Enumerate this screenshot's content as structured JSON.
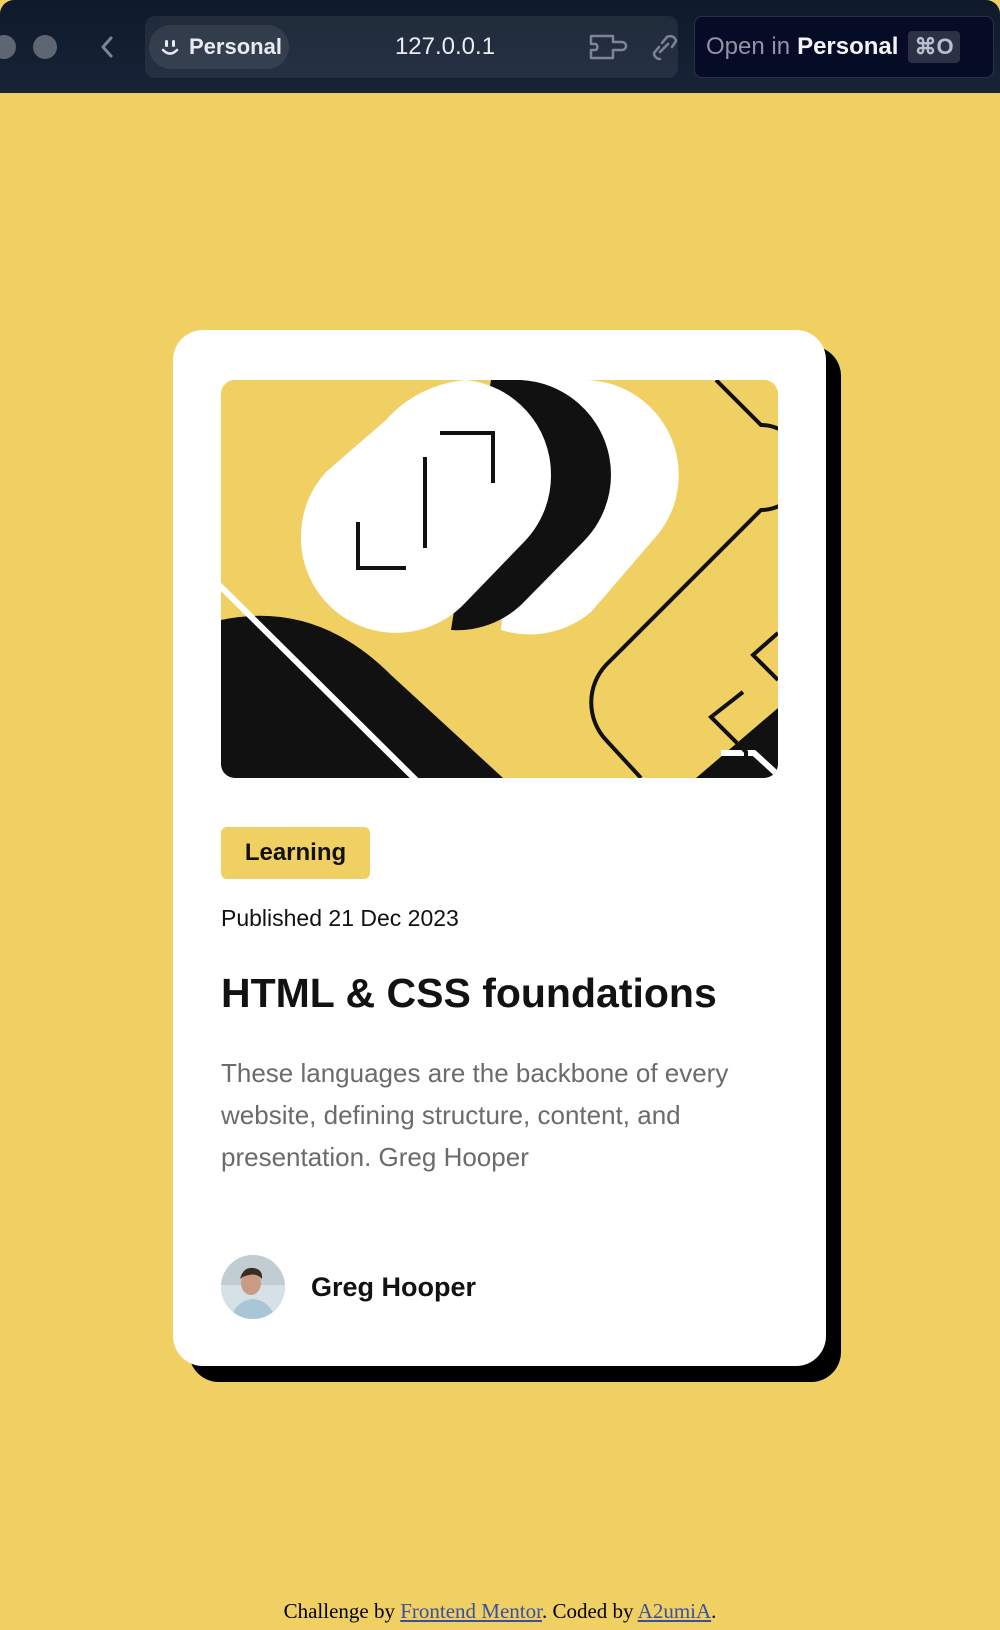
{
  "browser": {
    "profile_label": "Personal",
    "url": "127.0.0.1",
    "open_in_prefix": "Open in",
    "open_in_target": "Personal",
    "open_in_shortcut": "⌘O",
    "icons": [
      "back-chevron-icon",
      "smiley-profile-icon",
      "extension-icon",
      "link-icon"
    ]
  },
  "card": {
    "tag": "Learning",
    "published": "Published 21 Dec 2023",
    "title": "HTML & CSS foundations",
    "description": "These languages are the backbone of every website, defining structure, content, and presentation. Greg Hooper",
    "author": "Greg Hooper"
  },
  "footer": {
    "prefix": "Challenge by ",
    "link1": "Frontend Mentor",
    "middle": ". Coded by ",
    "link2": "A2umiA",
    "suffix": "."
  },
  "colors": {
    "background": "#F0D063",
    "card": "#FFFFFF",
    "text": "#121212",
    "muted_text": "#6B6B6B",
    "shadow": "#000000"
  }
}
